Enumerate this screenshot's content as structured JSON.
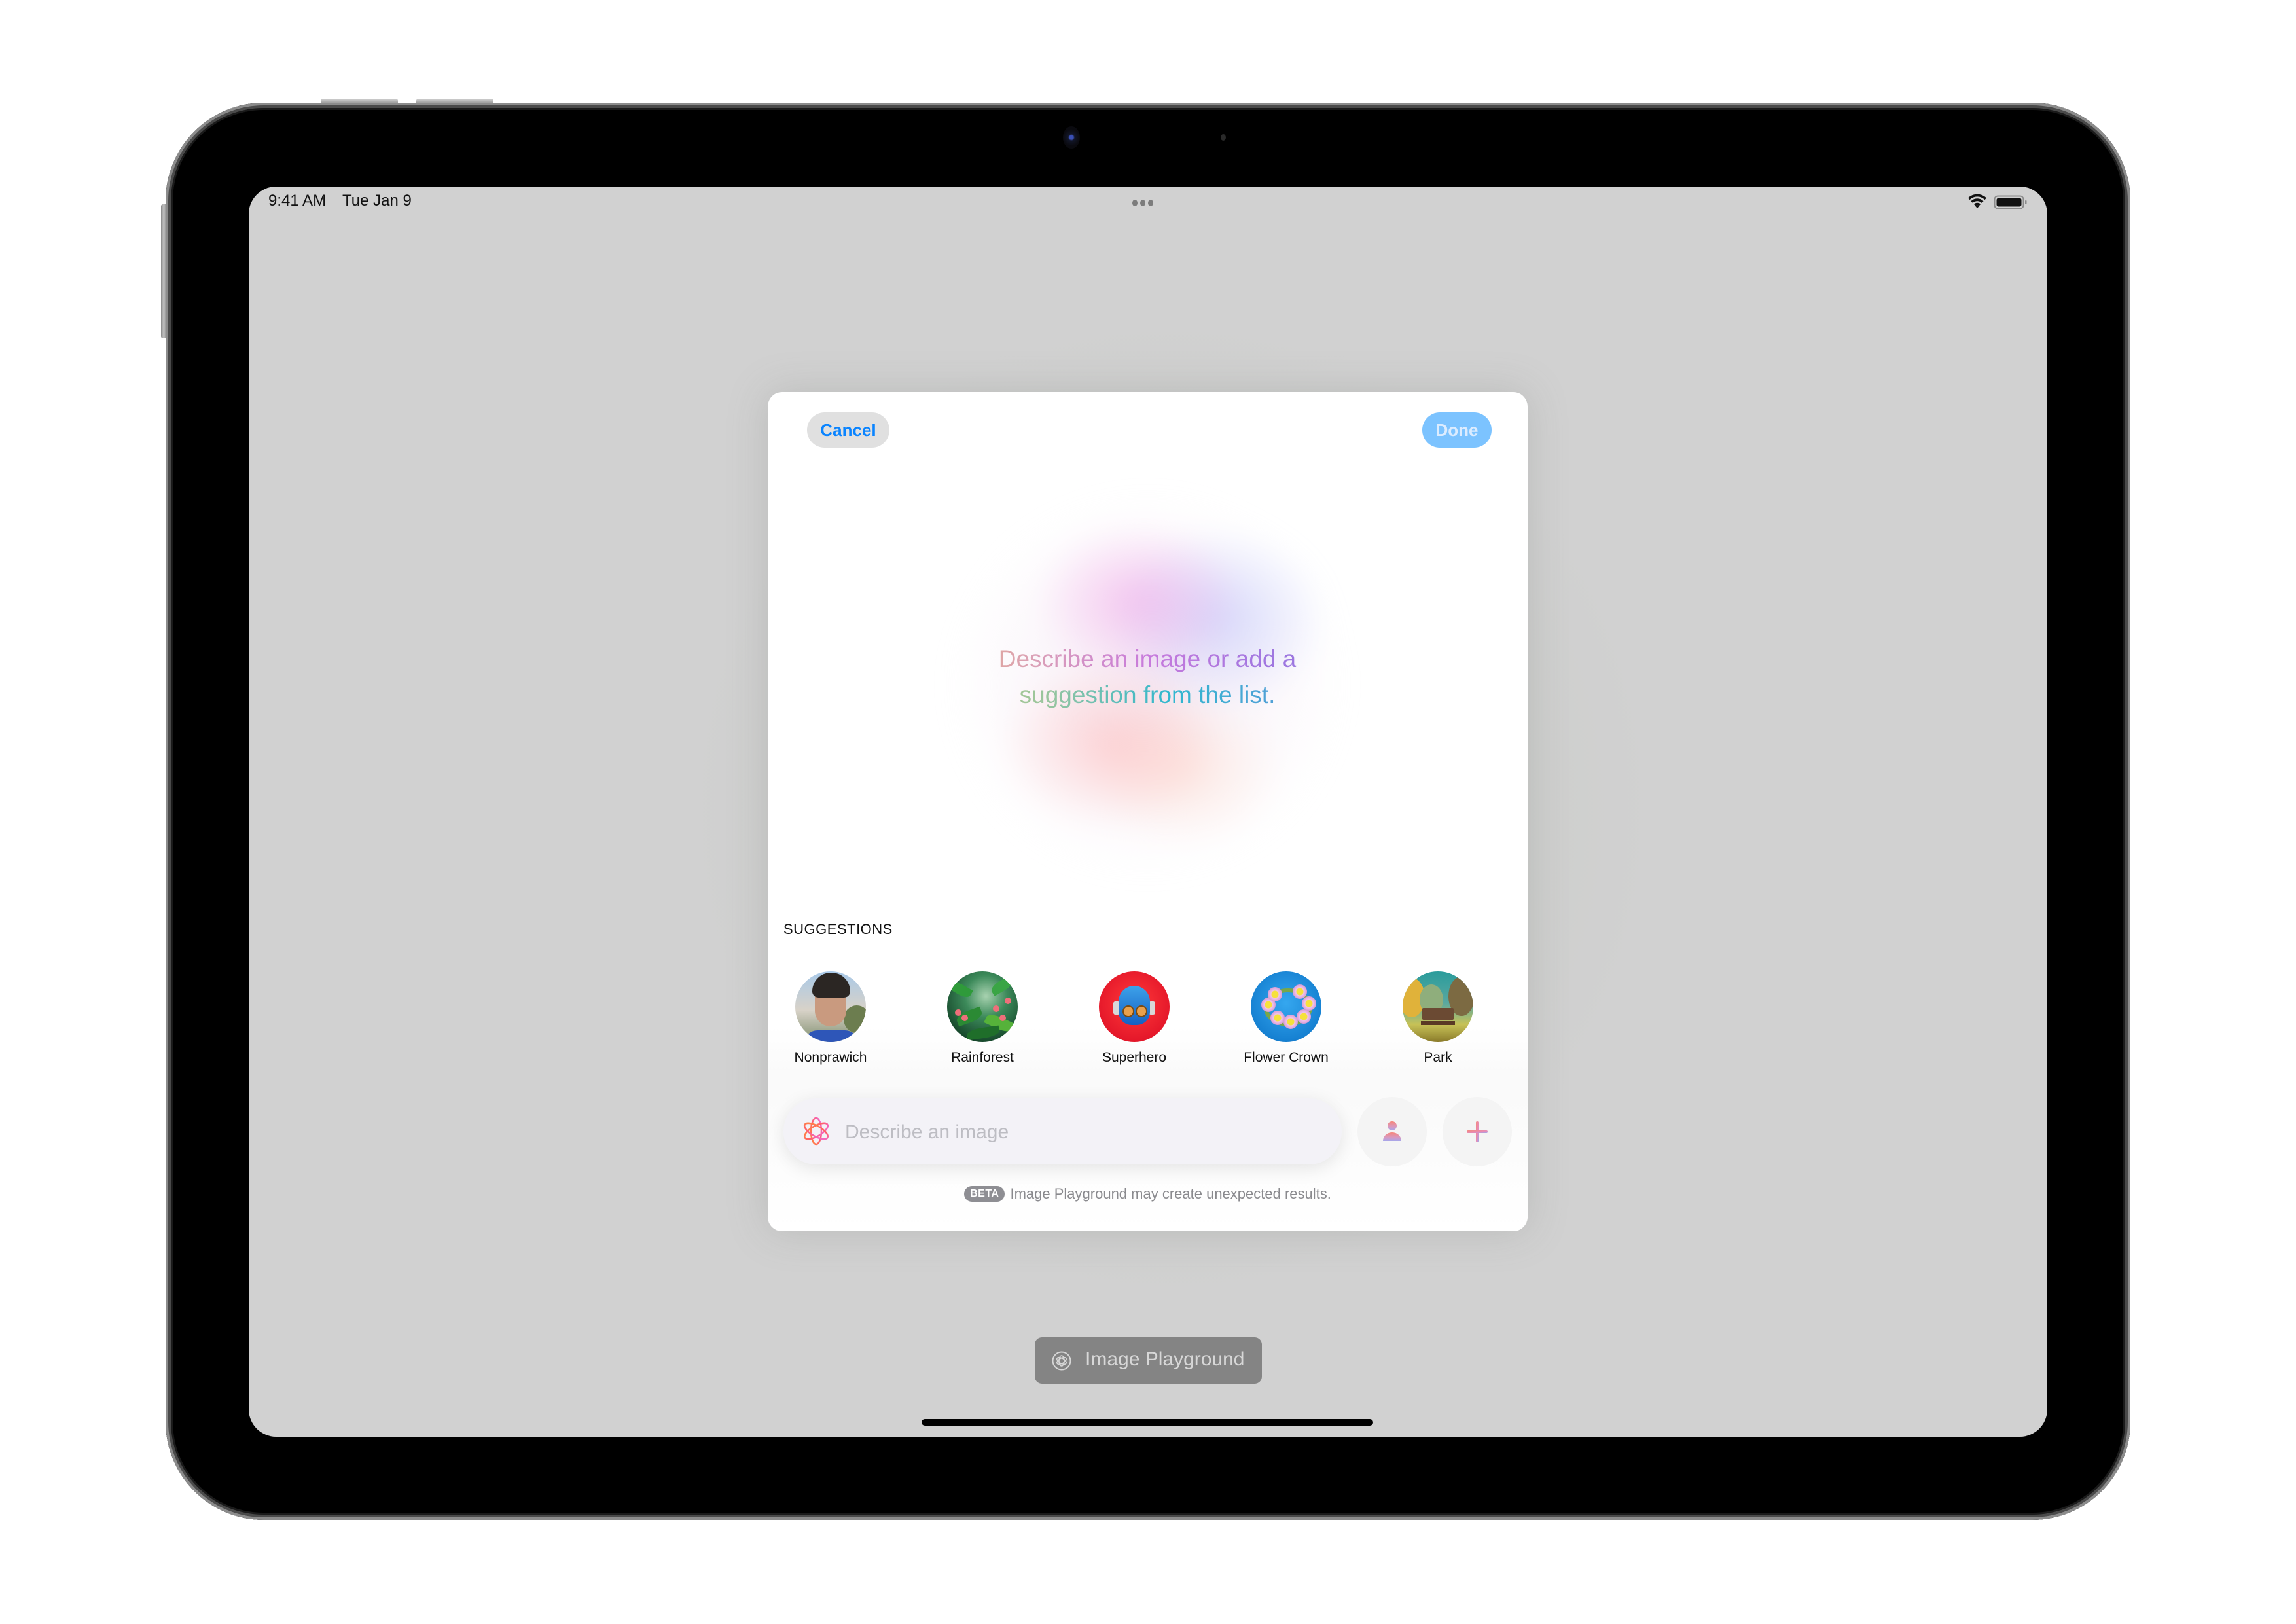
{
  "status_bar": {
    "time": "9:41 AM",
    "date": "Tue Jan 9",
    "wifi_icon": "wifi-icon",
    "battery_icon": "battery-icon"
  },
  "sheet": {
    "cancel_label": "Cancel",
    "done_label": "Done",
    "prompt_line1": "Describe an image or add a",
    "prompt_line2": "suggestion from the list.",
    "suggestions_heading": "SUGGESTIONS",
    "suggestions": [
      {
        "label": "Nonprawich",
        "icon": "person-photo"
      },
      {
        "label": "Rainforest",
        "icon": "rainforest-image"
      },
      {
        "label": "Superhero",
        "icon": "superhero-image"
      },
      {
        "label": "Flower Crown",
        "icon": "flower-crown-image"
      },
      {
        "label": "Park",
        "icon": "park-image"
      }
    ],
    "input": {
      "placeholder": "Describe an image",
      "value": "",
      "icon": "image-playground-icon"
    },
    "person_button_icon": "person-icon",
    "add_button_icon": "plus-icon",
    "beta_badge": "BETA",
    "beta_note": "Image Playground may create unexpected results."
  },
  "background_app": {
    "button_label": "Image Playground",
    "button_icon": "image-playground-icon"
  },
  "colors": {
    "accent_blue": "#0a84ff",
    "done_disabled": "#7cc3ff",
    "screen_bg": "#d1d1d1",
    "beta_badge": "#8e8e93"
  }
}
